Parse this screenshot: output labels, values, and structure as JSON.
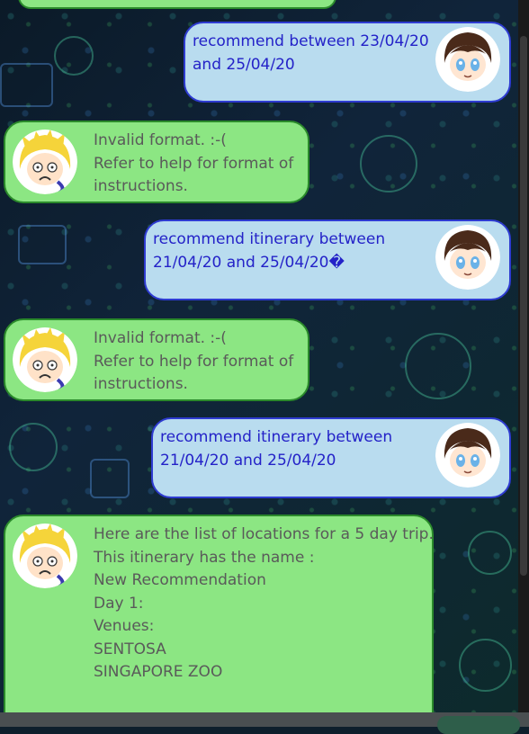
{
  "chat": {
    "messages": [
      {
        "sender": "user",
        "lines": [
          "recommend between 23/04/20",
          "and 25/04/20"
        ]
      },
      {
        "sender": "bot",
        "lines": [
          "Invalid format. :-(",
          "Refer to help for format of",
          "instructions."
        ]
      },
      {
        "sender": "user",
        "lines": [
          "recommend itinerary between",
          "21/04/20 and 25/04/20�"
        ]
      },
      {
        "sender": "bot",
        "lines": [
          "Invalid format. :-(",
          "Refer to help for format of",
          "instructions."
        ]
      },
      {
        "sender": "user",
        "lines": [
          "recommend itinerary between",
          "21/04/20 and 25/04/20"
        ]
      },
      {
        "sender": "bot",
        "lines": [
          "Here are the list of locations for a 5 day trip.",
          "This itinerary has the name :",
          "New Recommendation",
          "",
          "Day 1:",
          "",
          "Venues:",
          "SENTOSA",
          "SINGAPORE ZOO"
        ]
      }
    ]
  },
  "colors": {
    "user_bubble": "#b9dcef",
    "user_border": "#2e3bd1",
    "user_text": "#2422c8",
    "bot_bubble": "#8ce683",
    "bot_border": "#2b8a2b",
    "bot_text": "#5a5a5a"
  },
  "icons": {
    "user_avatar": "dark-haired-user-avatar-icon",
    "bot_avatar": "blonde-bot-avatar-icon"
  }
}
